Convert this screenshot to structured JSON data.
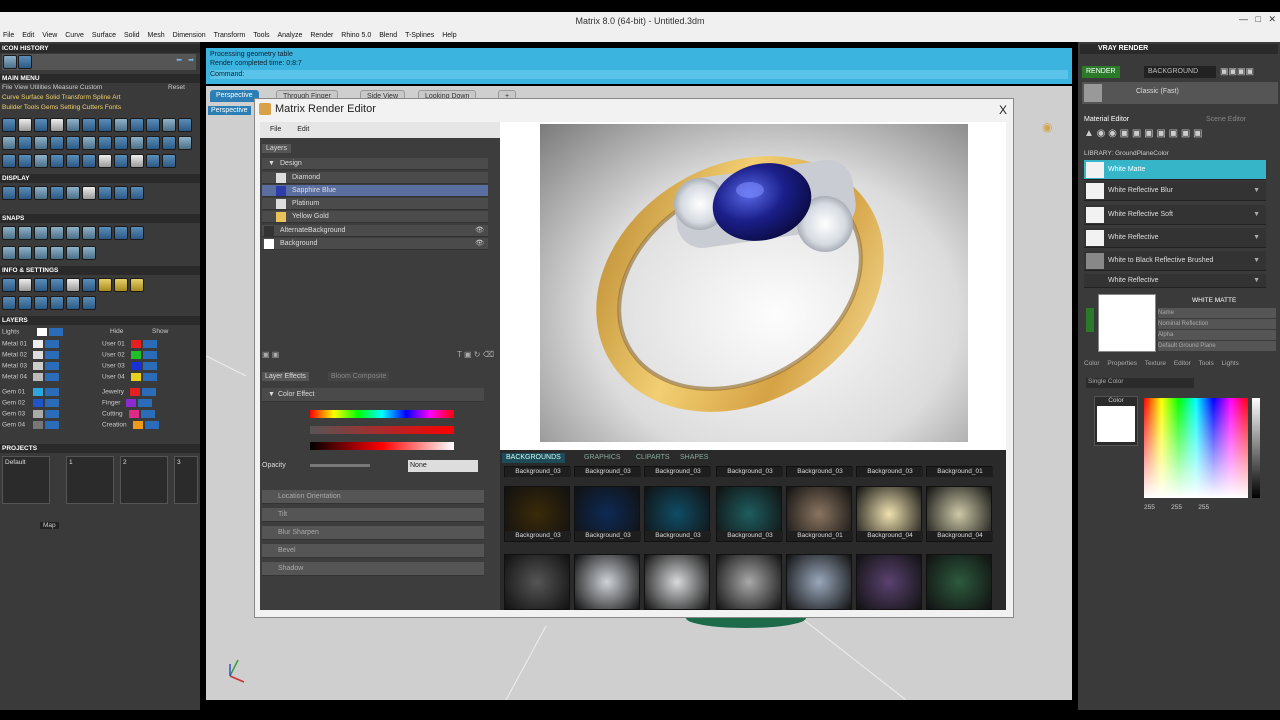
{
  "window": {
    "title": "Matrix 8.0 (64-bit) - Untitled.3dm"
  },
  "menu": [
    "File",
    "Edit",
    "View",
    "Curve",
    "Surface",
    "Solid",
    "Mesh",
    "Dimension",
    "Transform",
    "Tools",
    "Analyze",
    "Render",
    "Rhino 5.0",
    "Blend",
    "T-Splines",
    "Help"
  ],
  "left": {
    "icon_history": "ICON HISTORY",
    "main_menu": "MAIN MENU",
    "main_menu_items": "File  View  Utilities  Measure  Custom",
    "reset": "Reset",
    "tabs_row1": "Curve  Surface  Solid  Transform  Spline  Art",
    "tabs_row2": "Builder  Tools  Gems  Setting  Cutters  Fonts",
    "display": "DISPLAY",
    "snaps": "SNAPS",
    "info_settings": "INFO & SETTINGS",
    "layers": "LAYERS",
    "layer_header": {
      "lights": "Lights",
      "hide": "Hide",
      "show": "Show"
    },
    "layer_left": [
      "Metal 01",
      "Metal 02",
      "Metal 03",
      "Metal 04"
    ],
    "layer_right": [
      "User 01",
      "User 02",
      "User 03",
      "User 04"
    ],
    "gem_left": [
      "Gem 01",
      "Gem 02",
      "Gem 03",
      "Gem 04"
    ],
    "gem_right": [
      "Jewelry",
      "Finger",
      "Cutting",
      "Creation"
    ],
    "projects": "PROJECTS",
    "project_slots": [
      "Default",
      "1",
      "2",
      "3"
    ],
    "map": "Map"
  },
  "command": {
    "line1": "Processing geometry table",
    "line2": "Render completed time: 0:8:7",
    "prompt": "Command:"
  },
  "viewport_tabs": [
    "Perspective",
    "Through Finger",
    "Side View",
    "Looking Down",
    "+"
  ],
  "viewport_label": "Perspective",
  "editor": {
    "title": "Matrix Render Editor",
    "close": "X",
    "menu": [
      "File",
      "Edit"
    ],
    "layers_tab": "Layers",
    "layer_items": [
      {
        "name": "Design",
        "group": true
      },
      {
        "name": "Diamond"
      },
      {
        "name": "Sapphire Blue",
        "selected": true
      },
      {
        "name": "Platinum"
      },
      {
        "name": "Yellow Gold"
      },
      {
        "name": "AlternateBackground"
      },
      {
        "name": "Background"
      }
    ],
    "effect_tabs": [
      "Layer Effects",
      "Bloom Composite"
    ],
    "effects": [
      "Color Effect",
      "Location Orientation",
      "Tilt",
      "Blur Sharpen",
      "Bevel",
      "Shadow"
    ],
    "opacity_label": "Opacity",
    "blend_mode": "None"
  },
  "browser": {
    "tabs": [
      "BACKGROUNDS",
      "GRAPHICS",
      "CLIPARTS",
      "SHAPES"
    ],
    "row0_labels": [
      "Background_03",
      "Background_03",
      "Background_03",
      "Background_03",
      "Background_03",
      "Background_03",
      "Background_01"
    ],
    "row1_labels": [
      "Background_03",
      "Background_03",
      "Background_03",
      "Background_03",
      "Background_01",
      "Background_04",
      "Background_04"
    ],
    "row1_colors": [
      "#3a2a08",
      "#0d2a55",
      "#0f4d66",
      "#1e5d5f",
      "#8a7560",
      "#efe2b0",
      "#cdc9a8"
    ],
    "row2_colors": [
      "#555",
      "#cfd3d8",
      "#d9dadc",
      "#a9a9a9",
      "#9aa8bc",
      "#5a4270",
      "#2d5a3e"
    ]
  },
  "right": {
    "vray_title": "VRAY RENDER",
    "render_btn": "RENDER",
    "preset": "BACKGROUND",
    "classic": "Classic (Fast)",
    "material_editor": "Material Editor",
    "scene_editor": "Scene Editor",
    "library_path": "LIBRARY: GroundPlaneColor",
    "materials": [
      "White Matte",
      "White Reflective Blur",
      "White Reflective Soft",
      "White Reflective",
      "White to Black Reflective Brushed",
      "White Reflective"
    ],
    "selected_material_title": "WHITE MATTE",
    "mat_props": [
      "Name",
      "Nominal Reflection",
      "Alpha",
      "Default Ground Plane"
    ],
    "color_tabs": [
      "Color",
      "Properties",
      "Texture",
      "Editor",
      "Tools",
      "Lights"
    ],
    "color_mode": "Single Color",
    "color_label": "Color",
    "rgb": [
      "255",
      "255",
      "255"
    ]
  },
  "colors": {
    "accent_blue": "#3bb4e0",
    "selected_teal": "#36b5c8"
  }
}
